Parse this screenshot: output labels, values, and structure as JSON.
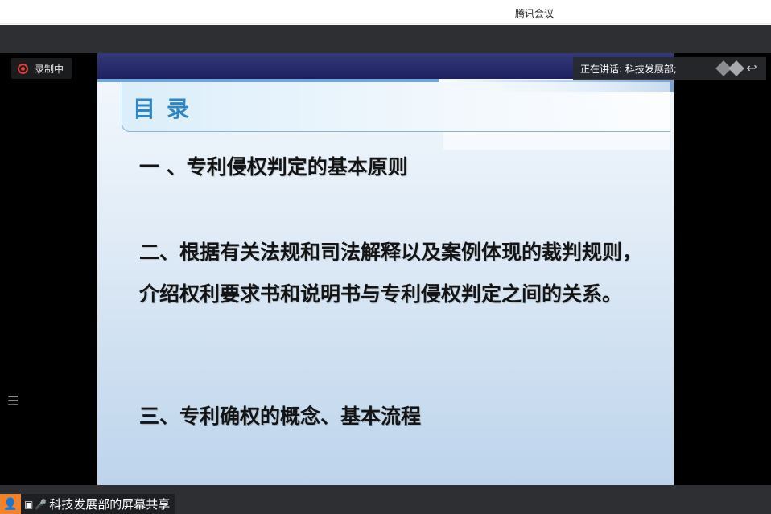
{
  "window": {
    "title": "腾讯会议"
  },
  "recording": {
    "label": "录制中"
  },
  "speaker": {
    "label": "正在讲话: 科技发展部;"
  },
  "slide": {
    "title": "目录",
    "items": [
      "一 、专利侵权判定的基本原则",
      "二、根据有关法规和司法解释以及案例体现的裁判规则，介绍权利要求书和说明书与专利侵权判定之间的关系。",
      "三、专利确权的概念、基本流程"
    ]
  },
  "share": {
    "label": "科技发展部的屏幕共享"
  },
  "icons": {
    "record": "record-icon",
    "return": "return-icon",
    "list": "list-icon",
    "user": "user-icon",
    "screen": "screen-share-icon",
    "mic": "microphone-icon"
  },
  "colors": {
    "title_accent": "#2e86c9",
    "recording_red": "#e03c3c",
    "user_orange": "#f0832c"
  }
}
